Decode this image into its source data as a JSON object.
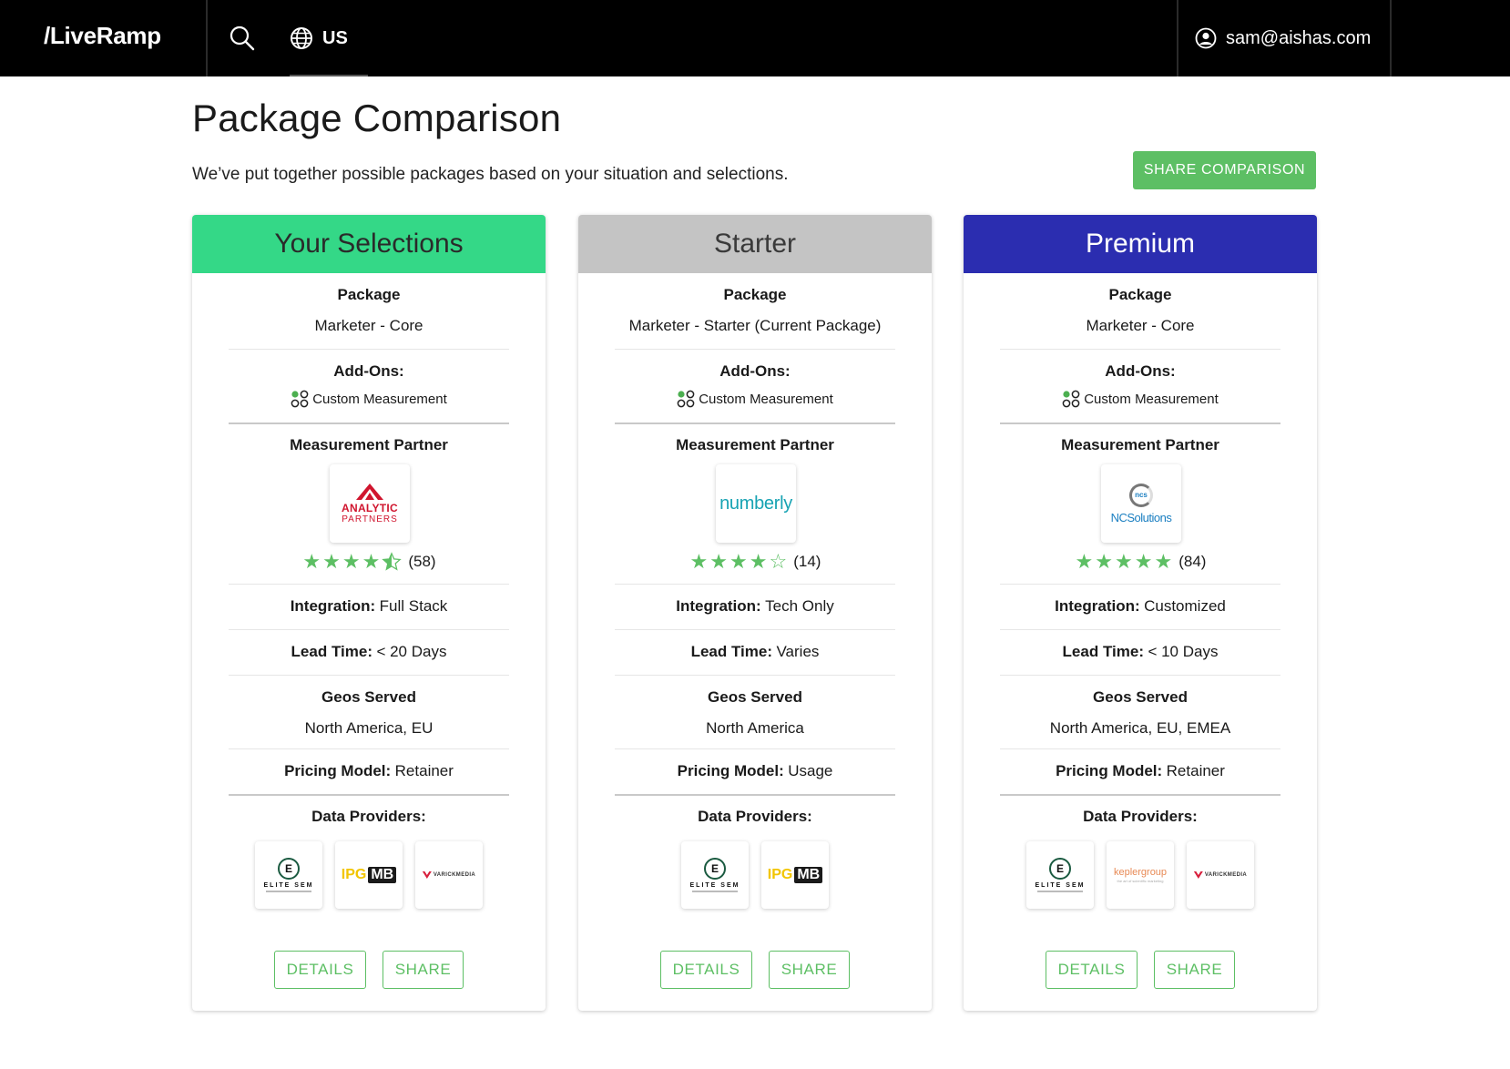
{
  "nav": {
    "logo": "/LiveRamp",
    "region": "US",
    "user_email": "sam@aishas.com"
  },
  "page": {
    "title": "Package Comparison",
    "subtitle": "We’ve put together possible packages based on your situation and selections.",
    "share_button": "SHARE COMPARISON"
  },
  "labels": {
    "package": "Package",
    "addons": "Add-Ons:",
    "measurement_partner": "Measurement Partner",
    "integration": "Integration:",
    "lead_time": "Lead Time:",
    "geos_served": "Geos Served",
    "pricing_model": "Pricing Model:",
    "data_providers": "Data Providers:",
    "details": "DETAILS",
    "share": "SHARE"
  },
  "cards": [
    {
      "title": "Your Selections",
      "header_color": "#34d887",
      "package": "Marketer - Core",
      "addon": "Custom Measurement",
      "partner": {
        "logo": "analytic-partners-logo",
        "line1": "ANALYTIC",
        "line2": "PARTNERS"
      },
      "rating": 4.5,
      "rating_count": "(58)",
      "integration": "Full Stack",
      "lead_time": "< 20 Days",
      "geos": "North America, EU",
      "pricing": "Retainer",
      "providers": [
        "elite-sem",
        "ipg-mb",
        "varick-media"
      ]
    },
    {
      "title": "Starter",
      "header_color": "#c4c4c4",
      "package": "Marketer - Starter (Current Package)",
      "addon": "Custom Measurement",
      "partner": {
        "logo": "numberly-logo",
        "line1": "numberly"
      },
      "rating": 4,
      "rating_count": "(14)",
      "integration": "Tech Only",
      "lead_time": "Varies",
      "geos": "North America",
      "pricing": "Usage",
      "providers": [
        "elite-sem",
        "ipg-mb"
      ]
    },
    {
      "title": "Premium",
      "header_color": "#2b2db0",
      "package": "Marketer - Core",
      "addon": "Custom Measurement",
      "partner": {
        "logo": "ncsolutions-logo",
        "line1": "ncs",
        "line2": "NCSolutions"
      },
      "rating": 5,
      "rating_count": "(84)",
      "integration": "Customized",
      "lead_time": "< 10 Days",
      "geos": "North America, EU, EMEA",
      "pricing": "Retainer",
      "providers": [
        "elite-sem",
        "kepler-group",
        "varick-media"
      ]
    }
  ],
  "provider_logos": {
    "elite-sem": {
      "mark": "E",
      "text": "ELITE SEM"
    },
    "ipg-mb": {
      "a": "IPG",
      "b": "MB"
    },
    "varick-media": {
      "text": "VARICKMEDIA"
    },
    "kepler-group": {
      "a": "keplergroup",
      "b": "the art of scientific marketing"
    }
  },
  "colors": {
    "accent_green": "#5dbf64",
    "star_green": "#5dbf64",
    "nav_bg": "#000000"
  },
  "icons": {
    "search": "search-icon",
    "region": "globe-icon",
    "user": "user-circle-icon",
    "addon": "custom-measurement-icon",
    "star": "star-icon"
  }
}
